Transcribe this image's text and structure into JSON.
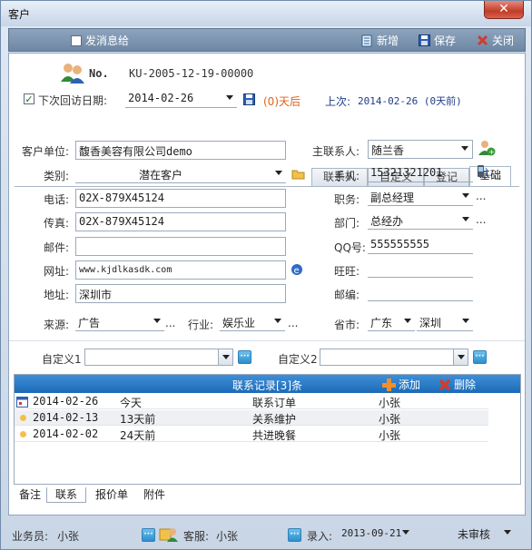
{
  "window": {
    "title": "客户",
    "close_glyph": "✕"
  },
  "toolbar": {
    "send_msg": "发消息给",
    "new": "新增",
    "save": "保存",
    "close": "关闭"
  },
  "record": {
    "no_label": "No.",
    "no_value": "KU-2005-12-19-00000",
    "next_visit_label": "下次回访日期:",
    "next_visit_date": "2014-02-26",
    "days_after": "(0)天后",
    "last_visit_label": "上次:",
    "last_visit_value": "2014-02-26 (0天前)"
  },
  "tabs": [
    "联系人",
    "自定义",
    "登记",
    "基础"
  ],
  "form": {
    "company_label": "客户单位:",
    "company_value": "馥香美容有限公司demo",
    "category_label": "类别:",
    "category_value": "潜在客户",
    "phone_label": "电话:",
    "phone_value": "02X-879X45124",
    "fax_label": "传真:",
    "fax_value": "02X-879X45124",
    "email_label": "邮件:",
    "email_value": "",
    "website_label": "网址:",
    "website_value": "www.kjdlkasdk.com",
    "address_label": "地址:",
    "address_value": "深圳市",
    "source_label": "来源:",
    "source_value": "广告",
    "industry_label": "行业:",
    "industry_value": "娱乐业",
    "main_contact_label": "主联系人:",
    "main_contact_value": "随兰香",
    "mobile_label": "手机:",
    "mobile_value": "15321321201",
    "position_label": "职务:",
    "position_value": "副总经理",
    "dept_label": "部门:",
    "dept_value": "总经办",
    "qq_label": "QQ号:",
    "qq_value": "555555555",
    "wangwang_label": "旺旺:",
    "wangwang_value": "",
    "postcode_label": "邮编:",
    "postcode_value": "",
    "province_label": "省市:",
    "province_value": "广东",
    "city_value": "深圳",
    "custom1_label": "自定义1",
    "custom2_label": "自定义2",
    "ellipsis": "..."
  },
  "contact_records": {
    "header": "联系记录[3]条",
    "add": "添加",
    "delete": "删除",
    "rows": [
      {
        "date": "2014-02-26",
        "ago": "今天",
        "subject": "联系订单",
        "person": "小张"
      },
      {
        "date": "2014-02-13",
        "ago": "13天前",
        "subject": "关系维护",
        "person": "小张"
      },
      {
        "date": "2014-02-02",
        "ago": "24天前",
        "subject": "共进晚餐",
        "person": "小张"
      }
    ]
  },
  "bottom_tabs": [
    "备注",
    "联系",
    "报价单",
    "附件"
  ],
  "status": {
    "salesperson_label": "业务员:",
    "salesperson_value": "小张",
    "service_label": "客服:",
    "service_value": "小张",
    "entry_label": "录入:",
    "entry_value": "2013-09-21",
    "audit_value": "未审核"
  },
  "colors": {
    "header_blue": "#1c6ab8",
    "accent_red": "#d23c2a",
    "accent_orange": "#f0902a"
  }
}
